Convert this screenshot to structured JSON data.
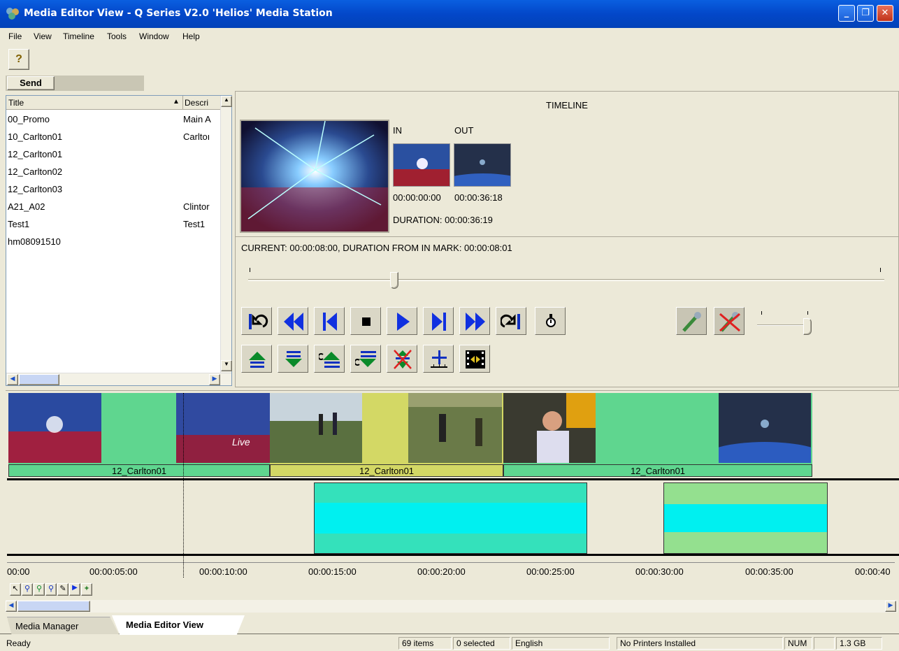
{
  "window": {
    "title": "Media Editor View - Q Series V2.0 'Helios' Media Station",
    "min": "_",
    "max": "❐",
    "close": "✕"
  },
  "menu": [
    "File",
    "View",
    "Timeline",
    "Tools",
    "Window",
    "Help"
  ],
  "toolbar": {
    "help_icon": "?",
    "send_label": "Send"
  },
  "list": {
    "col_title": "Title",
    "col_desc": "Descri",
    "sort_indicator": "▲",
    "rows": [
      {
        "title": "00_Promo",
        "desc": "Main A"
      },
      {
        "title": "10_Carlton01",
        "desc": "Carltoı"
      },
      {
        "title": "12_Carlton01",
        "desc": ""
      },
      {
        "title": "12_Carlton02",
        "desc": ""
      },
      {
        "title": "12_Carlton03",
        "desc": ""
      },
      {
        "title": "A21_A02",
        "desc": "Clintor"
      },
      {
        "title": "Test1",
        "desc": "Test1"
      },
      {
        "title": "hm08091510",
        "desc": ""
      }
    ]
  },
  "preview": {
    "heading": "TIMELINE",
    "in_label": "IN",
    "out_label": "OUT",
    "in_time": "00:00:00:00",
    "out_time": "00:00:36:18",
    "duration": "DURATION: 00:00:36:19",
    "current": "CURRENT: 00:00:08:00, DURATION FROM IN MARK: 00:00:08:01",
    "scrub_position": 0.23
  },
  "timeline": {
    "clips": [
      {
        "label": "12_Carlton01",
        "color": "#5fd68f"
      },
      {
        "label": "12_Carlton01",
        "color": "#d3d865"
      },
      {
        "label": "12_Carlton01",
        "color": "#5fd68f"
      }
    ],
    "ruler": [
      "00:00",
      "00:00:05:00",
      "00:00:10:00",
      "00:00:15:00",
      "00:00:20:00",
      "00:00:25:00",
      "00:00:30:00",
      "00:00:35:00",
      "00:00:40"
    ]
  },
  "tabs": {
    "tab1": "Media Manager",
    "tab2": "Media Editor View"
  },
  "status": {
    "ready": "Ready",
    "items": "69 items",
    "selected": "0 selected",
    "lang": "English",
    "printers": "No Printers Installed",
    "num": "NUM",
    "size": "1.3 GB"
  }
}
